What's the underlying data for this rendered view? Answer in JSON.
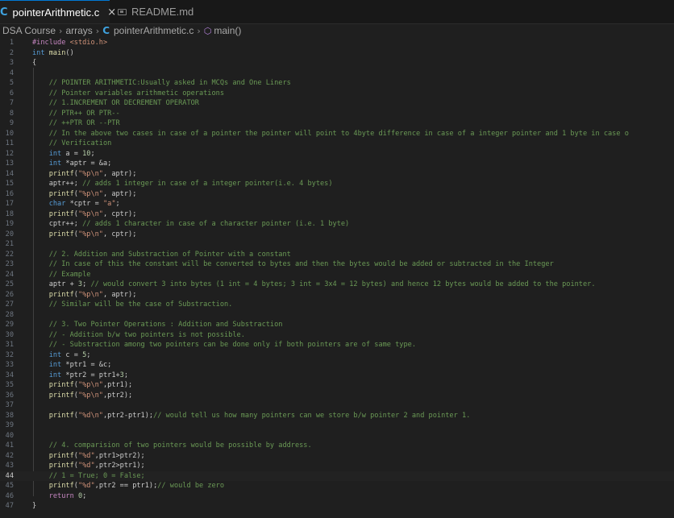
{
  "tabs": [
    {
      "label": "pointerArithmetic.c",
      "close": "×",
      "active": true
    },
    {
      "label": "README.md",
      "active": false
    }
  ],
  "breadcrumb": {
    "items": [
      "DSA Course",
      "arrays",
      "pointerArithmetic.c",
      "main()"
    ],
    "separator": "›"
  },
  "editor": {
    "current_line": 44,
    "colors": {
      "keyword": "#569cd6",
      "control": "#c586c0",
      "function": "#dcdcaa",
      "string": "#ce9178",
      "number": "#b5cea8",
      "comment": "#6a9955",
      "variable": "#cccccc",
      "preprocessor": "#c586c0",
      "include_path": "#ce9178"
    },
    "lines": [
      "#include <stdio.h>",
      "int main()",
      "{",
      "",
      "    // POINTER ARITHMETIC:Usually asked in MCQs and One Liners",
      "    // Pointer variables arithmetic operations",
      "    // 1.INCREMENT OR DECREMENT OPERATOR",
      "    // PTR++ OR PTR--",
      "    // ++PTR OR --PTR",
      "    // In the above two cases in case of a pointer the pointer will point to 4byte difference in case of a integer pointer and 1 byte in case o",
      "    // Verification",
      "    int a = 10;",
      "    int *aptr = &a;",
      "    printf(\"%p\\n\", aptr);",
      "    aptr++; // adds 1 integer in case of a integer pointer(i.e. 4 bytes)",
      "    printf(\"%p\\n\", aptr);",
      "    char *cptr = \"a\";",
      "    printf(\"%p\\n\", cptr);",
      "    cptr++; // adds 1 character in case of a character pointer (i.e. 1 byte)",
      "    printf(\"%p\\n\", cptr);",
      "",
      "    // 2. Addition and Substraction of Pointer with a constant",
      "    // In case of this the constant will be converted to bytes and then the bytes would be added or subtracted in the Integer",
      "    // Example",
      "    aptr + 3; // would convert 3 into bytes (1 int = 4 bytes; 3 int = 3x4 = 12 bytes) and hence 12 bytes would be added to the pointer.",
      "    printf(\"%p\\n\", aptr);",
      "    // Similar will be the case of Substraction.",
      "",
      "    // 3. Two Pointer Operations : Addition and Substraction",
      "    // - Addition b/w two pointers is not possible.",
      "    // - Substraction among two pointers can be done only if both pointers are of same type.",
      "    int c = 5;",
      "    int *ptr1 = &c;",
      "    int *ptr2 = ptr1+3;",
      "    printf(\"%p\\n\",ptr1);",
      "    printf(\"%p\\n\",ptr2);",
      "",
      "    printf(\"%d\\n\",ptr2-ptr1);// would tell us how many pointers can we store b/w pointer 2 and pointer 1.",
      "",
      "",
      "    // 4. comparision of two pointers would be possible by address.",
      "    printf(\"%d\",ptr1>ptr2);",
      "    printf(\"%d\",ptr2>ptr1);",
      "    // 1 = True; 0 = False;",
      "    printf(\"%d\",ptr2 == ptr1);// would be zero",
      "    return 0;",
      "}"
    ]
  }
}
